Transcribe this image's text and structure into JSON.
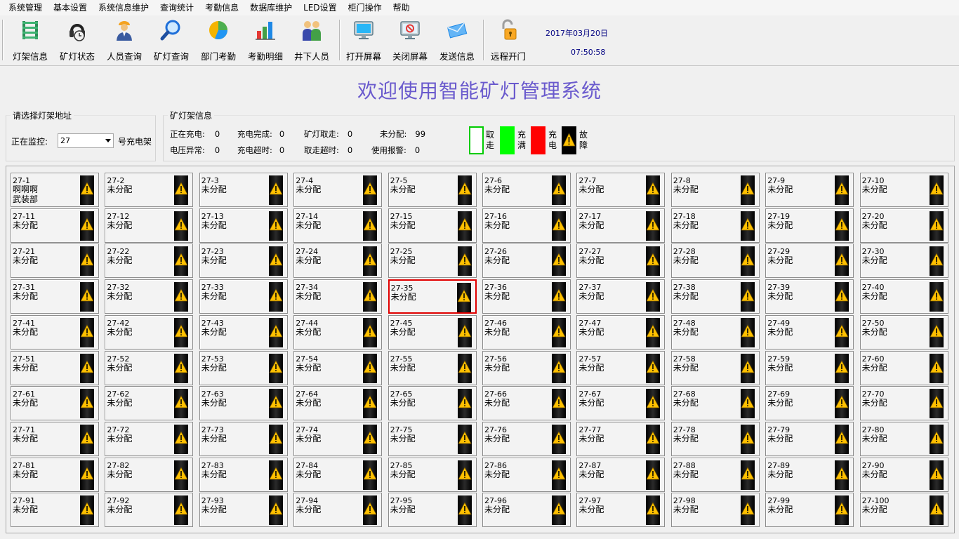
{
  "menu": [
    "系统管理",
    "基本设置",
    "系统信息维护",
    "查询统计",
    "考勤信息",
    "数据库维护",
    "LED设置",
    "柜门操作",
    "帮助"
  ],
  "toolbar": {
    "buttons": [
      {
        "label": "灯架信息",
        "icon": "lamp-rack-icon"
      },
      {
        "label": "矿灯状态",
        "icon": "lamp-status-icon"
      },
      {
        "label": "人员查询",
        "icon": "person-search-icon"
      },
      {
        "label": "矿灯查询",
        "icon": "magnifier-icon"
      },
      {
        "label": "部门考勤",
        "icon": "pie-chart-icon"
      },
      {
        "label": "考勤明细",
        "icon": "bar-chart-icon"
      },
      {
        "label": "井下人员",
        "icon": "people-icon"
      },
      {
        "label": "打开屏幕",
        "icon": "monitor-on-icon"
      },
      {
        "label": "关闭屏幕",
        "icon": "monitor-off-icon"
      },
      {
        "label": "发送信息",
        "icon": "envelope-icon"
      },
      {
        "label": "远程开门",
        "icon": "padlock-icon"
      }
    ],
    "date": "2017年03月20日",
    "time": "07:50:58"
  },
  "title": "欢迎使用智能矿灯管理系统",
  "rack_select": {
    "group_title": "请选择灯架地址",
    "label": "正在监控:",
    "value": "27",
    "suffix": "号充电架"
  },
  "rack_info": {
    "group_title": "矿灯架信息",
    "stats": [
      {
        "label": "正在充电:",
        "value": "0"
      },
      {
        "label": "充电完成:",
        "value": "0"
      },
      {
        "label": "矿灯取走:",
        "value": "0"
      },
      {
        "label": "未分配:",
        "value": "99"
      },
      {
        "label": "电压异常:",
        "value": "0"
      },
      {
        "label": "充电超时:",
        "value": "0"
      },
      {
        "label": "取走超时:",
        "value": "0"
      },
      {
        "label": "使用报警:",
        "value": "0"
      }
    ]
  },
  "legend": [
    {
      "label": "取走",
      "color": "#ffffff",
      "border": "#00cc00"
    },
    {
      "label": "充满",
      "color": "#00ff00",
      "border": "#00ff00"
    },
    {
      "label": "充电",
      "color": "#ff0000",
      "border": "#ff0000"
    },
    {
      "label": "故障",
      "color": "#000000",
      "border": "#000000"
    }
  ],
  "slots": {
    "prefix": "27-",
    "count": 100,
    "columns": 10,
    "default_status": "未分配",
    "selected_index": 35,
    "first_slot": {
      "status": "啊啊啊",
      "dept": "武装部"
    }
  },
  "colors": {
    "title": "#6a5acd",
    "clock": "#000080",
    "selected_border": "#e00000",
    "warning_yellow": "#ffc000"
  }
}
